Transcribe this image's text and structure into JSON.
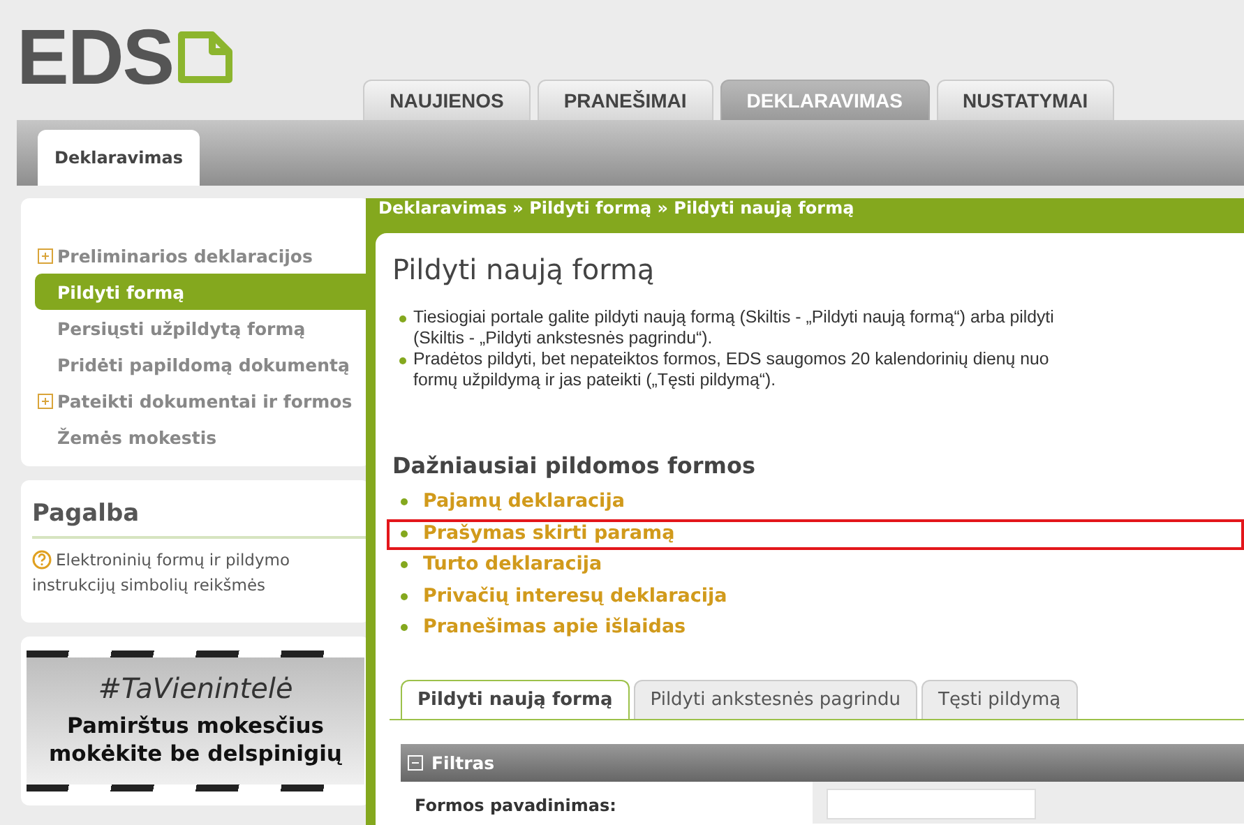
{
  "logo": {
    "text": "EDS"
  },
  "main_tabs": [
    {
      "label": "NAUJIENOS",
      "selected": false
    },
    {
      "label": "PRANEŠIMAI",
      "selected": false
    },
    {
      "label": "DEKLARAVIMAS",
      "selected": true
    },
    {
      "label": "NUSTATYMAI",
      "selected": false
    }
  ],
  "sub_tabs": [
    {
      "label": "Deklaravimas",
      "selected": true
    }
  ],
  "sidebar": {
    "items": [
      {
        "label": "Preliminarios deklaracijos",
        "expandable": true,
        "selected": false
      },
      {
        "label": "Pildyti formą",
        "expandable": false,
        "selected": true
      },
      {
        "label": "Persiųsti užpildytą formą",
        "expandable": false,
        "selected": false
      },
      {
        "label": "Pridėti papildomą dokumentą",
        "expandable": false,
        "selected": false
      },
      {
        "label": "Pateikti dokumentai ir formos",
        "expandable": true,
        "selected": false
      },
      {
        "label": "Žemės mokestis",
        "expandable": false,
        "selected": false
      }
    ]
  },
  "help": {
    "title": "Pagalba",
    "link": "Elektroninių formų ir pildymo instrukcijų simbolių reikšmės"
  },
  "banner": {
    "hashtag": "#TaVienintelė",
    "text": "Pamirštus mokesčius mokėkite be delspinigių"
  },
  "breadcrumb": "Deklaravimas » Pildyti formą » Pildyti naują formą",
  "page_title": "Pildyti naują formą",
  "info": [
    [
      "Tiesiogiai portale galite pildyti naują formą (Skiltis - „Pildyti naują formą“) arba pildyti",
      "(Skiltis - „Pildyti ankstesnės pagrindu“)."
    ],
    [
      "Pradėtos pildyti, bet nepateiktos formos, EDS saugomos 20 kalendorinių dienų nuo",
      "formų užpildymą ir jas pateikti („Tęsti pildymą“)."
    ]
  ],
  "frequent_forms": {
    "title": "Dažniausiai pildomos formos",
    "items": [
      {
        "label": "Pajamų deklaracija",
        "highlighted": false
      },
      {
        "label": "Prašymas skirti paramą",
        "highlighted": true
      },
      {
        "label": "Turto deklaracija",
        "highlighted": false
      },
      {
        "label": "Privačių interesų deklaracija",
        "highlighted": false
      },
      {
        "label": "Pranešimas apie išlaidas",
        "highlighted": false
      }
    ]
  },
  "form_tabs": [
    {
      "label": "Pildyti naują formą",
      "selected": true
    },
    {
      "label": "Pildyti ankstesnės pagrindu",
      "selected": false
    },
    {
      "label": "Tęsti pildymą",
      "selected": false
    }
  ],
  "filter": {
    "title": "Filtras",
    "expanded": true,
    "field_label": "Formos pavadinimas:"
  }
}
